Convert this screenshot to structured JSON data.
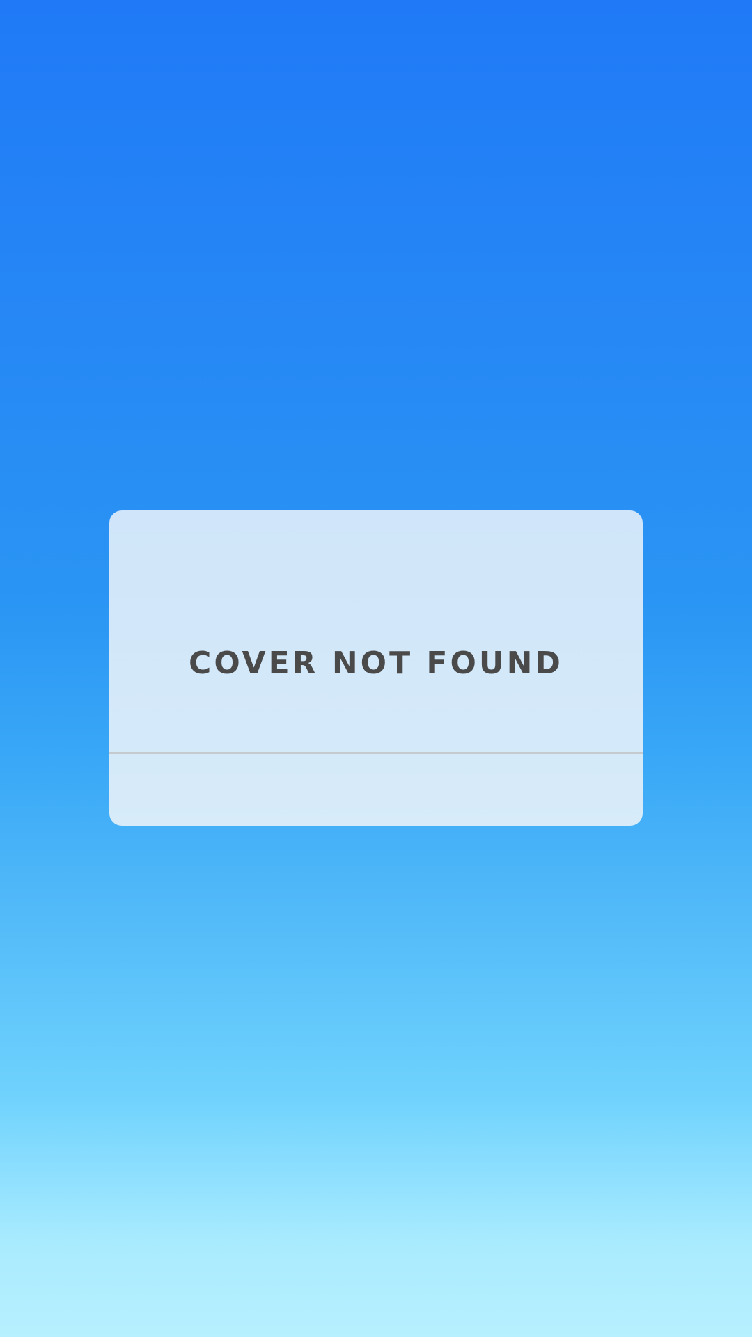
{
  "screen": {
    "background_top_color": "#207AF7",
    "background_bottom_color": "#B7F0FF"
  },
  "cover_card": {
    "message": "COVER NOT FOUND",
    "card_color": "#D2E7F9",
    "text_color": "#4A4A4A",
    "divider_color": "#C5CACF"
  }
}
